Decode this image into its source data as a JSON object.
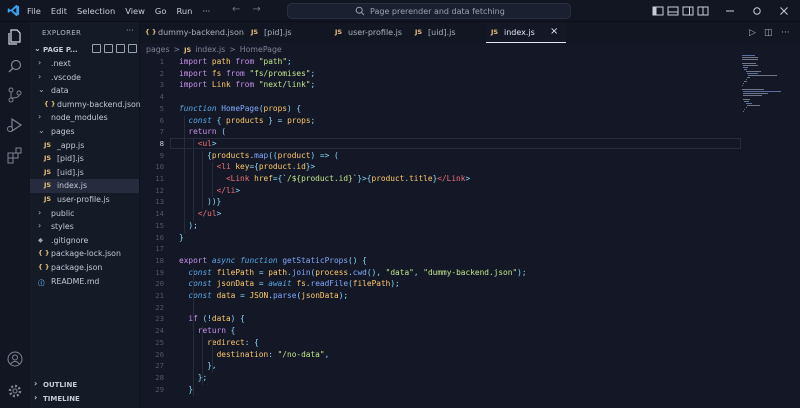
{
  "menu": [
    "File",
    "Edit",
    "Selection",
    "View",
    "Go",
    "Run",
    "···"
  ],
  "command_center": {
    "text": "Page prerender and data fetching"
  },
  "sidebar": {
    "title": "EXPLORER",
    "root": "PAGE P...",
    "tree": [
      {
        "label": ".next",
        "type": "folder",
        "depth": 1,
        "expanded": false
      },
      {
        "label": ".vscode",
        "type": "folder",
        "depth": 1,
        "expanded": false
      },
      {
        "label": "data",
        "type": "folder",
        "depth": 1,
        "expanded": true
      },
      {
        "label": "dummy-backend.json",
        "type": "json",
        "depth": 2
      },
      {
        "label": "node_modules",
        "type": "folder",
        "depth": 1,
        "expanded": false
      },
      {
        "label": "pages",
        "type": "folder",
        "depth": 1,
        "expanded": true
      },
      {
        "label": "_app.js",
        "type": "js",
        "depth": 2
      },
      {
        "label": "[pid].js",
        "type": "js",
        "depth": 2
      },
      {
        "label": "[uid].js",
        "type": "js",
        "depth": 2
      },
      {
        "label": "index.js",
        "type": "js",
        "depth": 2,
        "selected": true
      },
      {
        "label": "user-profile.js",
        "type": "js",
        "depth": 2
      },
      {
        "label": "public",
        "type": "folder",
        "depth": 1,
        "expanded": false
      },
      {
        "label": "styles",
        "type": "folder",
        "depth": 1,
        "expanded": false
      },
      {
        "label": ".gitignore",
        "type": "git",
        "depth": 1
      },
      {
        "label": "package-lock.json",
        "type": "json",
        "depth": 1
      },
      {
        "label": "package.json",
        "type": "json",
        "depth": 1
      },
      {
        "label": "README.md",
        "type": "info",
        "depth": 1
      }
    ],
    "outline": "OUTLINE",
    "timeline": "TIMELINE"
  },
  "icon_labels": {
    "js": "JS",
    "json": "{ }"
  },
  "tabs": [
    {
      "label": "dummy-backend.json",
      "type": "json"
    },
    {
      "label": "[pid].js",
      "type": "js"
    },
    {
      "label": "user-profile.js",
      "type": "js"
    },
    {
      "label": "[uid].js",
      "type": "js"
    },
    {
      "label": "index.js",
      "type": "js",
      "active": true
    }
  ],
  "breadcrumb": [
    "pages",
    ">",
    "JS",
    "index.js",
    ">",
    "HomePage"
  ],
  "editor": {
    "current_line": 8,
    "lines": [
      "import path from \"path\";",
      "import fs from \"fs/promises\";",
      "import Link from \"next/link\";",
      "",
      "function HomePage(props) {",
      "  const { products } = props;",
      "  return (",
      "    <ul>",
      "      {products.map((product) => (",
      "        <li key={product.id}>",
      "          <Link href={`/${product.id}`}>{product.title}</Link>",
      "        </li>",
      "      ))}",
      "    </ul>",
      "  );",
      "}",
      "",
      "export async function getStaticProps() {",
      "  const filePath = path.join(process.cwd(), \"data\", \"dummy-backend.json\");",
      "  const jsonData = await fs.readFile(filePath);",
      "  const data = JSON.parse(jsonData);",
      "",
      "  if (!data) {",
      "    return {",
      "      redirect: {",
      "        destination: \"/no-data\",",
      "      },",
      "    };",
      "  }"
    ]
  },
  "colors": {
    "keyword": "#5aa9e6",
    "keyword_italic": "#c792ea",
    "string": "#c3e88d",
    "function": "#82aaff",
    "tag": "#f07178",
    "variable": "#ffcb6b",
    "js_icon": "#e5c07b",
    "json_icon": "#e5c07b",
    "background": "#141826"
  }
}
